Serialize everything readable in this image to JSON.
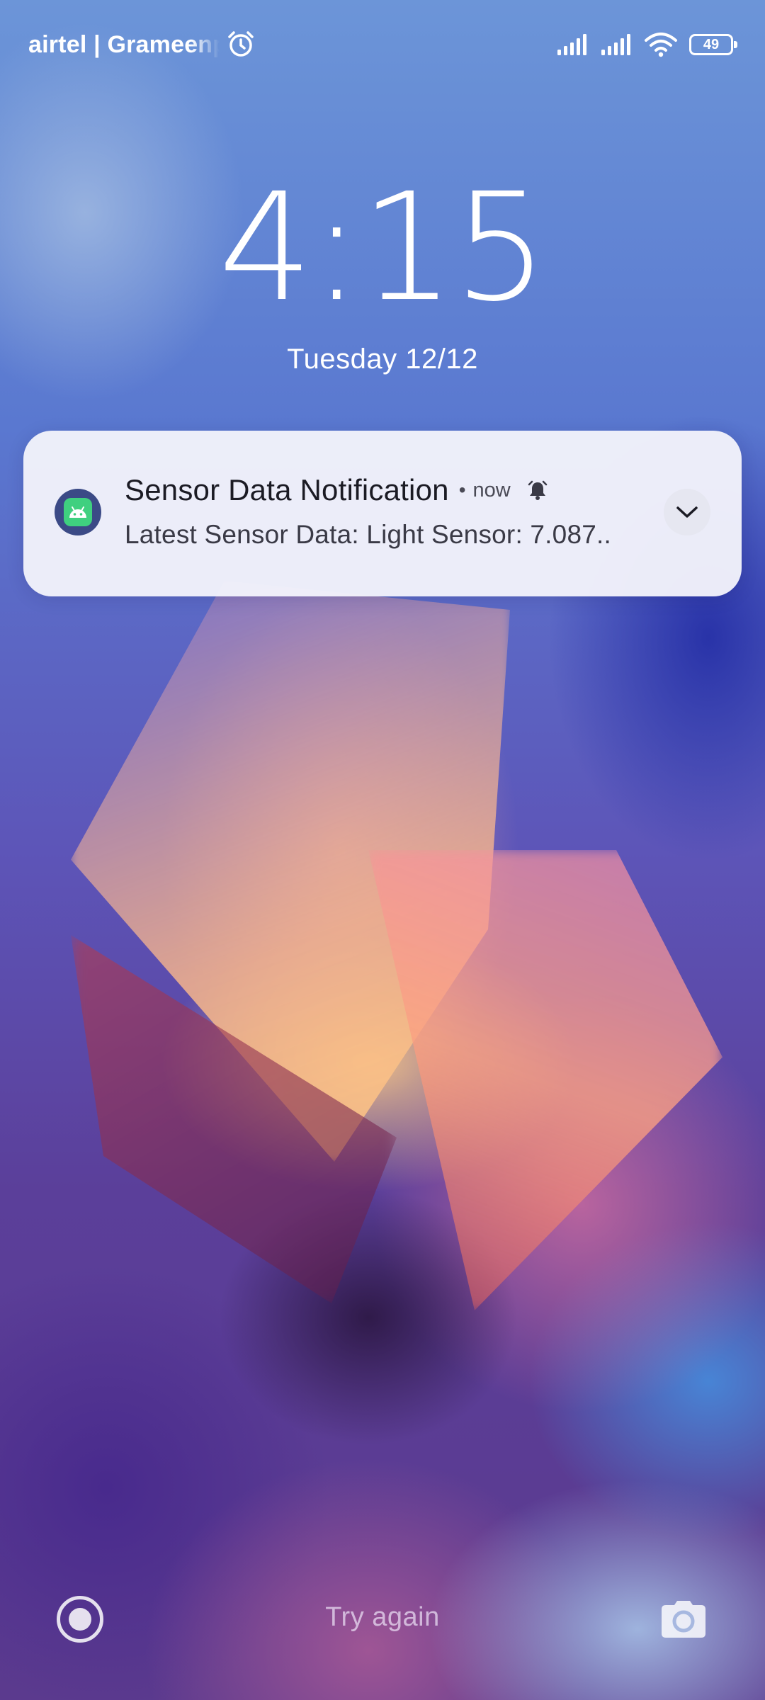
{
  "status_bar": {
    "carrier": "airtel | Grameenp",
    "battery_level": "49",
    "icons": [
      "alarm-icon",
      "signal-icon",
      "signal-icon",
      "wifi-icon",
      "battery-icon"
    ]
  },
  "lock_screen": {
    "time": "4:15",
    "date": "Tuesday 12/12"
  },
  "notification": {
    "app_icon": "android-icon",
    "title": "Sensor Data Notification",
    "separator": "•",
    "time": "now",
    "bell_icon": "alarm-bell-icon",
    "body": "Latest Sensor Data: Light Sensor: 7.087..",
    "expand_icon": "chevron-down-icon"
  },
  "bottom_bar": {
    "left_icon": "record-icon",
    "center_text": "Try again",
    "right_icon": "camera-icon"
  }
}
